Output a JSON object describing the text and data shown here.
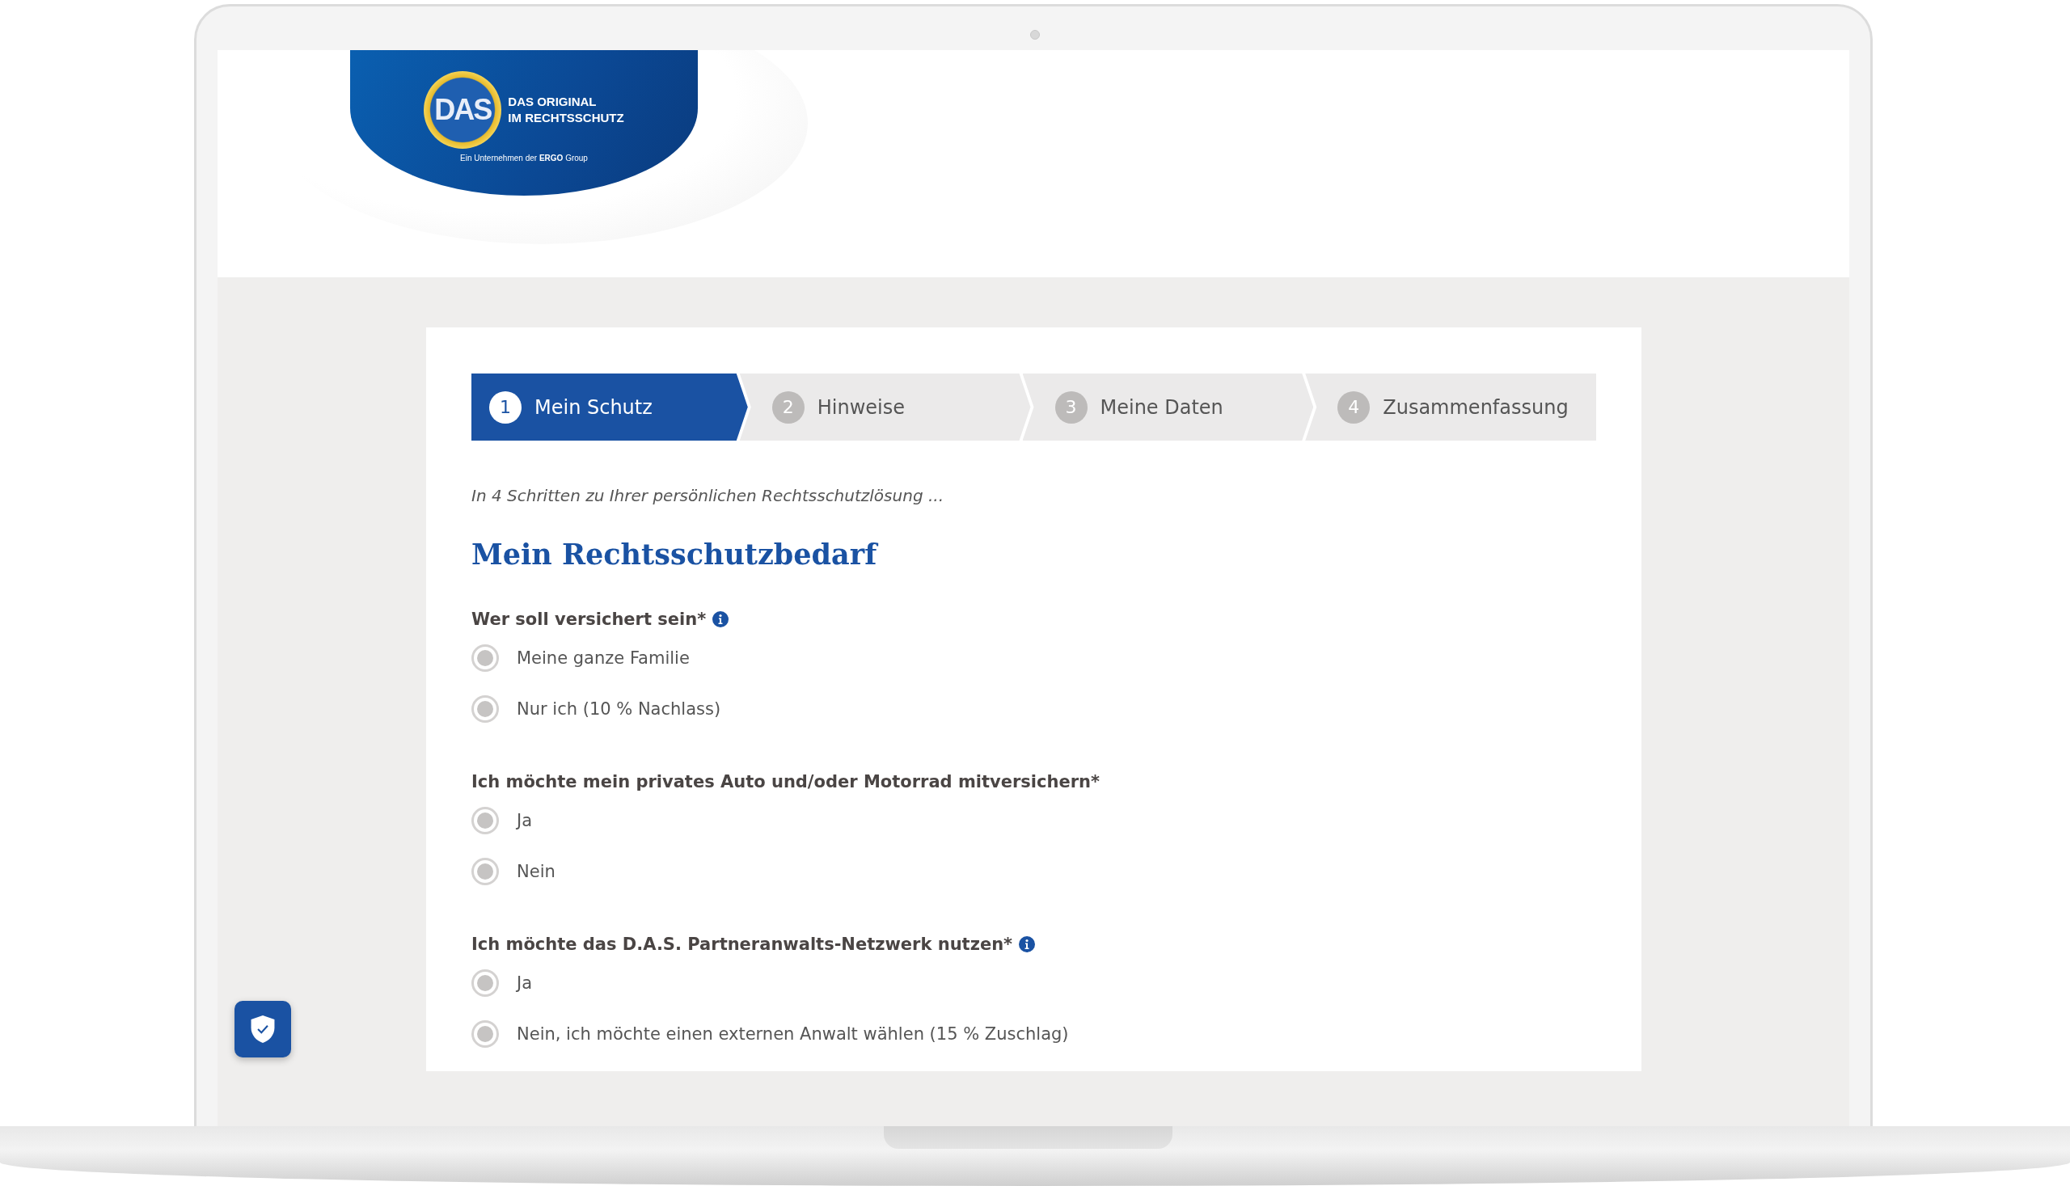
{
  "logo": {
    "seal": "DAS",
    "line_1": "DAS ORIGINAL",
    "line_2": "IM RECHTSSCHUTZ",
    "tagline": "Ein Unternehmen der **ERGO** Group"
  },
  "steps": [
    {
      "number": "1",
      "label": "Mein Schutz",
      "selected": true
    },
    {
      "number": "2",
      "label": "Hinweise",
      "selected": false
    },
    {
      "number": "3",
      "label": "Meine Daten",
      "selected": false
    },
    {
      "number": "4",
      "label": "Zusammenfassung",
      "selected": false
    }
  ],
  "intro": "In 4 Schritten zu Ihrer persönlichen Rechtsschutzlösung ...",
  "heading": "Mein Rechtsschutzbedarf",
  "questions": [
    {
      "label": "Wer soll versichert sein*",
      "info": true,
      "options": [
        {
          "label": "Meine ganze Familie",
          "selected": false
        },
        {
          "label": "Nur ich (10 % Nachlass)",
          "selected": false
        }
      ]
    },
    {
      "label": "Ich möchte mein privates Auto und/oder Motorrad mitversichern*",
      "info": false,
      "options": [
        {
          "label": "Ja",
          "selected": false
        },
        {
          "label": "Nein",
          "selected": false
        }
      ]
    },
    {
      "label": "Ich möchte das D.A.S. Partneranwalts-Netzwerk nutzen*",
      "info": true,
      "options": [
        {
          "label": "Ja",
          "selected": false
        },
        {
          "label": "Nein, ich möchte einen externen Anwalt wählen (15 % Zuschlag)",
          "selected": false
        }
      ]
    }
  ]
}
